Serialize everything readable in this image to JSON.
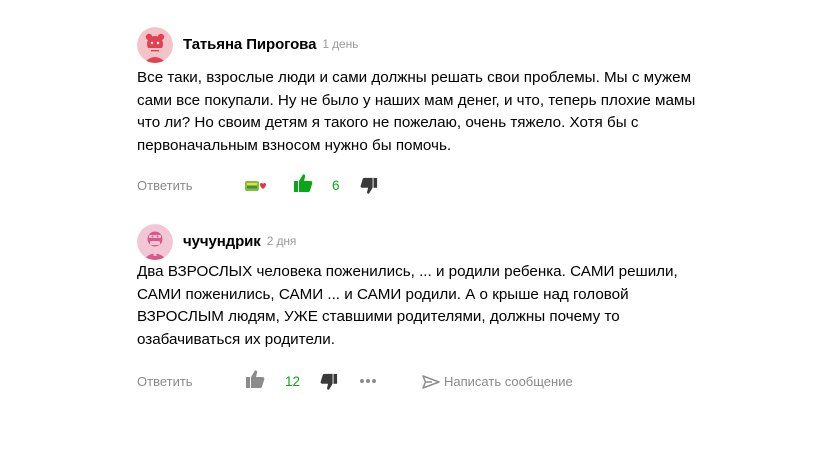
{
  "comments": [
    {
      "author": "Татьяна Пирогова",
      "time": "1 день",
      "text_lines": [
        "Все таки, взрослые люди и сами должны решать свои проблемы. Мы с мужем",
        "сами все покупали. Ну не было у наших мам денег, и что, теперь плохие мамы",
        "что ли? Но своим детям я такого не пожелаю, очень тяжело. Хотя бы с",
        "первоначальным взносом нужно бы помочь."
      ],
      "reply_label": "Ответить",
      "likes": "6",
      "like_active": true,
      "avatar_bg": "#f4c2c9",
      "avatar_fg": "#e0434f"
    },
    {
      "author": "чучундрик",
      "time": "2 дня",
      "text_lines": [
        "Два ВЗРОСЛЫХ человека поженились, ... и родили ребенка. САМИ решили,",
        "САМИ поженились, САМИ ... и САМИ родили. А о крыше над головой",
        "ВЗРОСЛЫМ людям, УЖЕ ставшими родителями, должны почему то",
        "озабачиваться их родители."
      ],
      "reply_label": "Ответить",
      "likes": "12",
      "like_active": false,
      "send_message_label": "Написать сообщение",
      "avatar_bg": "#f3c6d6",
      "avatar_fg": "#d85a8c"
    }
  ],
  "colors": {
    "like_active": "#0ba615",
    "icon_grey": "#8c8c8c",
    "dislike": "#3a3a3a",
    "meta_text": "#999999"
  },
  "icons": [
    "thumbs-up-icon",
    "thumbs-down-icon",
    "reactions-icon",
    "more-icon",
    "send-icon"
  ]
}
